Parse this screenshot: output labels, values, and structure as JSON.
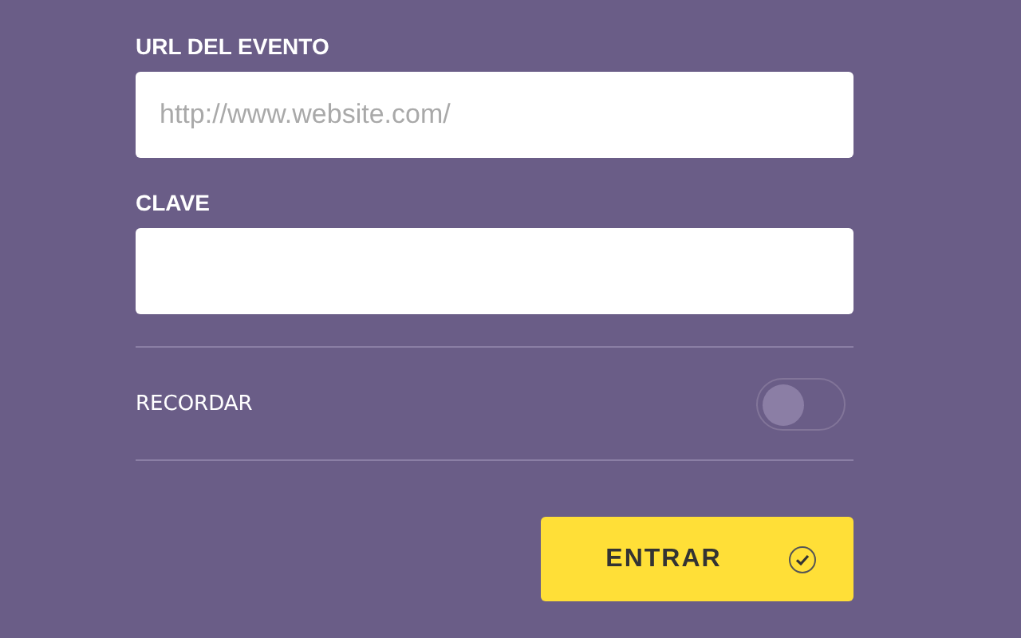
{
  "fields": [
    {
      "label": "URL DEL EVENTO",
      "placeholder": "http://www.website.com/"
    },
    {
      "label": "CLAVE"
    }
  ],
  "remember": {
    "label": "RECORDAR",
    "on": false
  },
  "submit": {
    "label": "ENTRAR"
  }
}
